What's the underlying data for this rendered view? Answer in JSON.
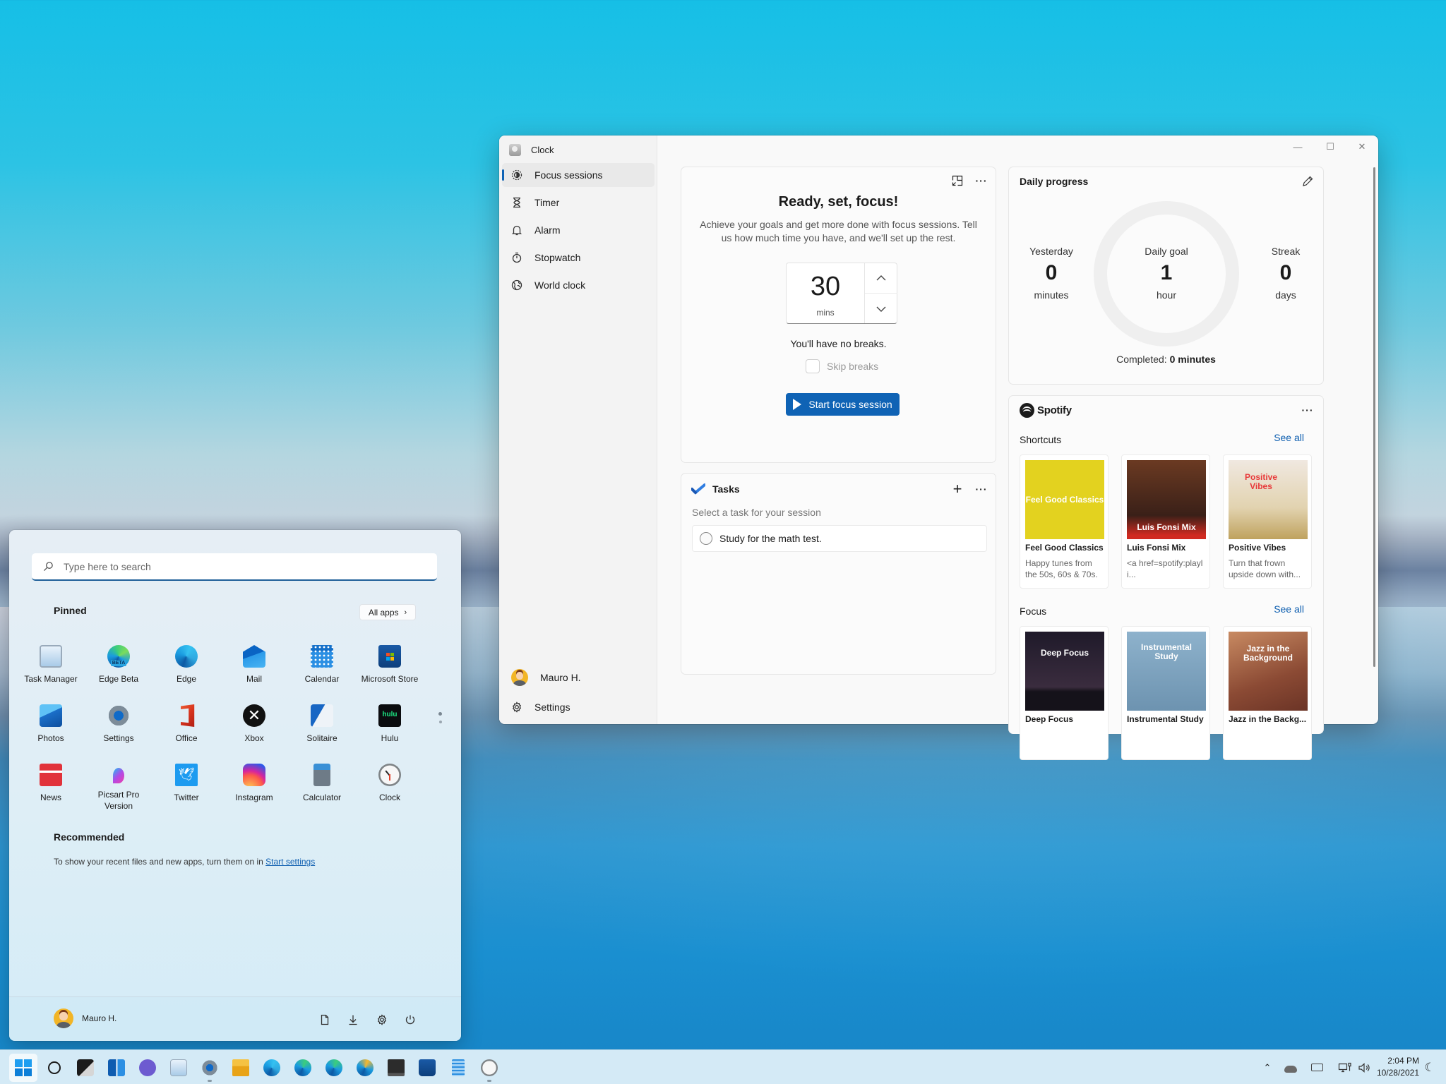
{
  "clock_app": {
    "title": "Clock",
    "nav": [
      {
        "label": "Focus sessions",
        "icon": "focus-icon",
        "selected": true
      },
      {
        "label": "Timer",
        "icon": "hourglass-icon"
      },
      {
        "label": "Alarm",
        "icon": "bell-icon"
      },
      {
        "label": "Stopwatch",
        "icon": "stopwatch-icon"
      },
      {
        "label": "World clock",
        "icon": "globe-icon"
      }
    ],
    "user_name": "Mauro H.",
    "settings_label": "Settings",
    "window_controls": {
      "minimize": "—",
      "maximize": "☐",
      "close": "✕"
    },
    "focus": {
      "heading": "Ready, set, focus!",
      "description": "Achieve your goals and get more done with focus sessions. Tell us how much time you have, and we'll set up the rest.",
      "duration_value": "30",
      "duration_unit": "mins",
      "breaks_text": "You'll have no breaks.",
      "skip_breaks_label": "Skip breaks",
      "skip_breaks_checked": false,
      "start_button": "Start focus session",
      "more_label": "···"
    },
    "tasks": {
      "title": "Tasks",
      "hint": "Select a task for your session",
      "add_label": "+",
      "more_label": "···",
      "items": [
        {
          "label": "Study for the math test.",
          "done": false
        }
      ]
    },
    "daily_progress": {
      "title": "Daily progress",
      "yesterday": {
        "label": "Yesterday",
        "value": "0",
        "unit": "minutes"
      },
      "daily_goal": {
        "label": "Daily goal",
        "value": "1",
        "unit": "hour"
      },
      "streak": {
        "label": "Streak",
        "value": "0",
        "unit": "days"
      },
      "completed_prefix": "Completed: ",
      "completed_value": "0 minutes",
      "progress_fraction": 0
    },
    "spotify": {
      "brand": "Spotify",
      "more_label": "···",
      "shortcuts": {
        "title": "Shortcuts",
        "see_all": "See all",
        "items": [
          {
            "art_text": "Feel Good Classics",
            "name": "Feel Good Classics",
            "sub": "Happy tunes from the 50s, 60s & 70s.",
            "art_color": "#e3d21f"
          },
          {
            "art_text": "Luis Fonsi Mix",
            "name": "Luis Fonsi Mix",
            "sub": "<a href=spotify:playli...",
            "art_color": "#5a2f20"
          },
          {
            "art_text": "Positive Vibes",
            "name": "Positive Vibes",
            "sub": "Turn that frown upside down with...",
            "art_color": "#e8dcc6"
          }
        ]
      },
      "focus": {
        "title": "Focus",
        "see_all": "See all",
        "items": [
          {
            "art_text": "Deep Focus",
            "name": "Deep Focus",
            "art_color": "#2a2230"
          },
          {
            "art_text": "Instrumental Study",
            "name": "Instrumental Study",
            "art_color": "#7ea6c2"
          },
          {
            "art_text": "Jazz in the Background",
            "name": "Jazz in the Backg...",
            "art_color": "#a8664a"
          }
        ]
      }
    }
  },
  "start_menu": {
    "search_placeholder": "Type here to search",
    "pinned_title": "Pinned",
    "all_apps_label": "All apps",
    "pinned_apps": [
      {
        "label": "Task Manager",
        "icon": "task-manager-icon"
      },
      {
        "label": "Edge Beta",
        "icon": "edge-beta-icon"
      },
      {
        "label": "Edge",
        "icon": "edge-icon"
      },
      {
        "label": "Mail",
        "icon": "mail-icon"
      },
      {
        "label": "Calendar",
        "icon": "calendar-icon"
      },
      {
        "label": "Microsoft Store",
        "icon": "store-icon"
      },
      {
        "label": "Photos",
        "icon": "photos-icon"
      },
      {
        "label": "Settings",
        "icon": "settings-icon"
      },
      {
        "label": "Office",
        "icon": "office-icon"
      },
      {
        "label": "Xbox",
        "icon": "xbox-icon"
      },
      {
        "label": "Solitaire",
        "icon": "solitaire-icon"
      },
      {
        "label": "Hulu",
        "icon": "hulu-icon"
      },
      {
        "label": "News",
        "icon": "news-icon"
      },
      {
        "label": "Picsart Pro Version",
        "icon": "picsart-icon"
      },
      {
        "label": "Twitter",
        "icon": "twitter-icon"
      },
      {
        "label": "Instagram",
        "icon": "instagram-icon"
      },
      {
        "label": "Calculator",
        "icon": "calculator-icon"
      },
      {
        "label": "Clock",
        "icon": "clock-icon"
      }
    ],
    "recommended_title": "Recommended",
    "recommended_text": "To show your recent files and new apps, turn them on in ",
    "recommended_link": "Start settings",
    "user_name": "Mauro H."
  },
  "taskbar": {
    "apps": [
      {
        "name": "start",
        "icon": "windows-start-icon",
        "active": true
      },
      {
        "name": "search",
        "icon": "search-icon"
      },
      {
        "name": "task-view",
        "icon": "task-view-icon"
      },
      {
        "name": "widgets",
        "icon": "widgets-icon"
      },
      {
        "name": "chat",
        "icon": "chat-icon"
      },
      {
        "name": "task-manager",
        "icon": "task-manager-icon"
      },
      {
        "name": "settings",
        "icon": "settings-icon",
        "running": true
      },
      {
        "name": "file-explorer",
        "icon": "folder-icon"
      },
      {
        "name": "edge",
        "icon": "edge-icon"
      },
      {
        "name": "edge-beta",
        "icon": "edge-beta-icon"
      },
      {
        "name": "edge-dev",
        "icon": "edge-dev-icon"
      },
      {
        "name": "edge-canary",
        "icon": "edge-canary-icon"
      },
      {
        "name": "terminal",
        "icon": "terminal-icon"
      },
      {
        "name": "store",
        "icon": "store-icon"
      },
      {
        "name": "notepad",
        "icon": "notepad-icon"
      },
      {
        "name": "clock",
        "icon": "clock-icon",
        "running": true
      }
    ],
    "time": "2:04 PM",
    "date": "10/28/2021"
  }
}
